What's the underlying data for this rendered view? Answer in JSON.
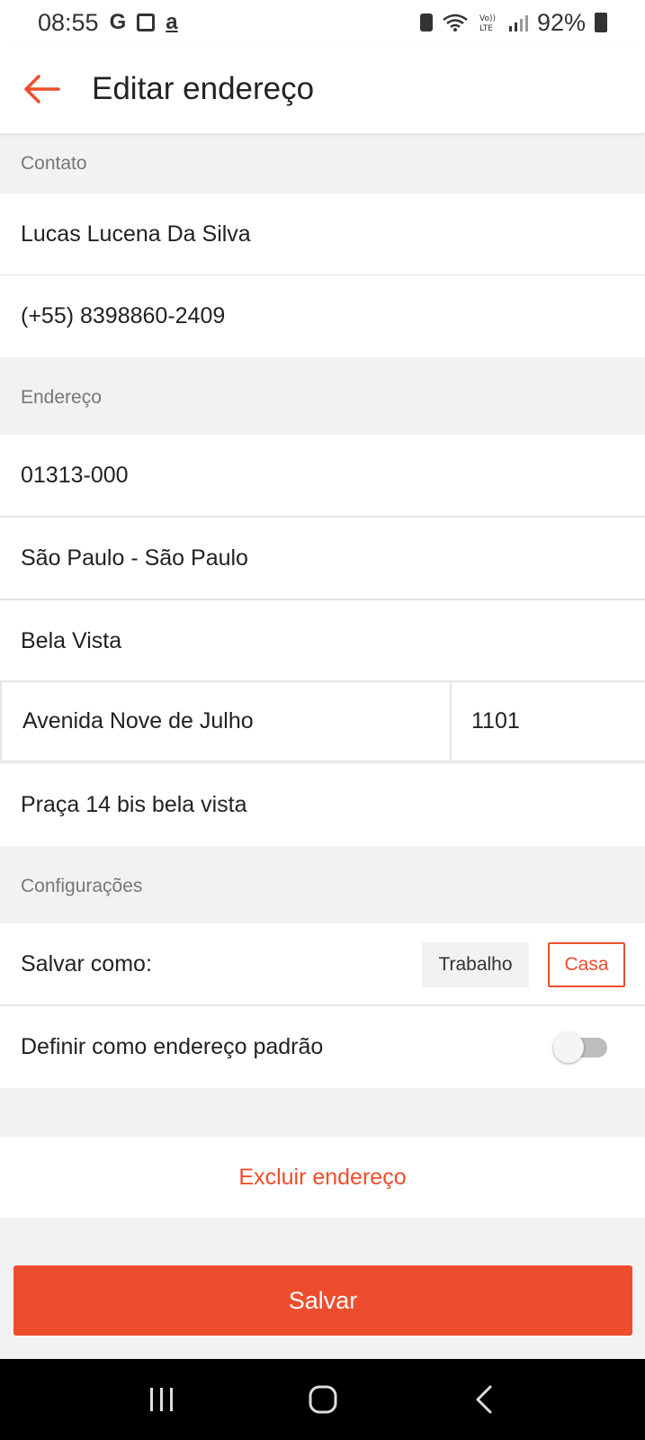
{
  "status_bar": {
    "time": "08:55",
    "left_icons": [
      "google-icon",
      "store-icon",
      "amazon-icon"
    ],
    "right_icons": [
      "battery-saver-icon",
      "wifi-icon",
      "volte-icon",
      "signal-icon"
    ],
    "battery": "92%"
  },
  "app_bar": {
    "title": "Editar endereço",
    "accent_color": "#ee4d2d"
  },
  "sections": {
    "contact_header": "Contato",
    "address_header": "Endereço",
    "settings_header": "Configurações"
  },
  "contact": {
    "name": "Lucas Lucena Da Silva",
    "phone": "(+55) 8398860-2409"
  },
  "address": {
    "zip": "01313-000",
    "city_state": "São Paulo - São Paulo",
    "neighborhood": "Bela Vista",
    "street": "Avenida Nove de Julho",
    "number": "1101",
    "complement": "Praça 14 bis bela vista"
  },
  "settings": {
    "save_as_label": "Salvar como:",
    "option_work": "Trabalho",
    "option_home": "Casa",
    "selected_option": "Casa",
    "default_label": "Definir como endereço padrão",
    "default_enabled": false
  },
  "actions": {
    "delete_label": "Excluir endereço",
    "save_label": "Salvar"
  },
  "nav_bar": {
    "icons": [
      "recent-apps-icon",
      "home-icon",
      "back-icon"
    ]
  }
}
